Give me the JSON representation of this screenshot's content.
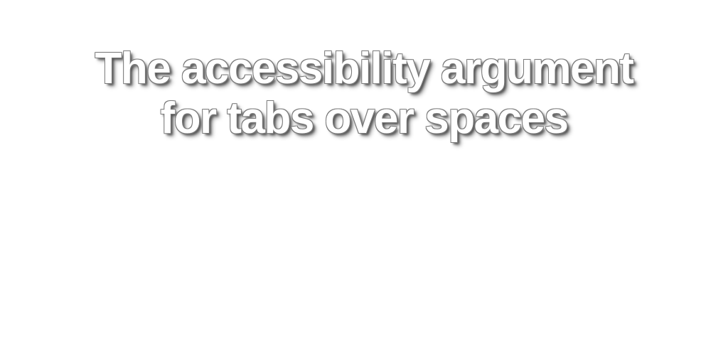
{
  "slide": {
    "title_line_1": "The accessibility argument",
    "title_line_2": "for tabs over spaces"
  }
}
